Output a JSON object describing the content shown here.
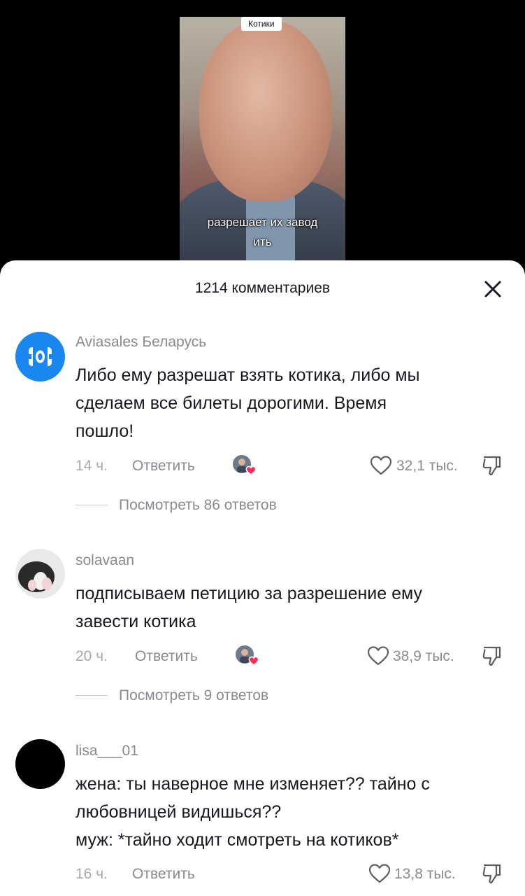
{
  "video": {
    "tag": "Котики",
    "caption_line1": "разрешает их завод",
    "caption_line2": "ить"
  },
  "sheet": {
    "title": "1214 комментариев"
  },
  "comments": [
    {
      "username": "Aviasales Беларусь",
      "text_lines": [
        "Либо ему разрешат взять котика, либо мы",
        "сделаем все билеты дорогими. Время",
        "пошло!"
      ],
      "time": "14 ч.",
      "reply_label": "Ответить",
      "likes": "32,1 тыс.",
      "view_replies": "Посмотреть 86 ответов"
    },
    {
      "username": "solavaan",
      "text_lines": [
        "подписываем петицию за разрешение ему",
        "завести котика"
      ],
      "time": "20 ч.",
      "reply_label": "Ответить",
      "likes": "38,9 тыс.",
      "view_replies": "Посмотреть 9 ответов"
    },
    {
      "username": "lisa___01",
      "text_lines": [
        "жена: ты наверное мне изменяет?? тайно с",
        "любовницей видишься??",
        "муж: *тайно ходит смотреть на котиков*"
      ],
      "time": "16 ч.",
      "reply_label": "Ответить",
      "likes": "13,8 тыс."
    }
  ],
  "icons": {
    "close": "close-icon",
    "like": "heart-outline-icon",
    "dislike": "thumbs-down-icon",
    "creator_liked": "creator-liked-avatar-icon"
  },
  "colors": {
    "accent_like": "#fe2c55",
    "aviasales_blue": "#1a86f0",
    "text_primary": "#161823",
    "text_secondary": "#8a8b91"
  }
}
